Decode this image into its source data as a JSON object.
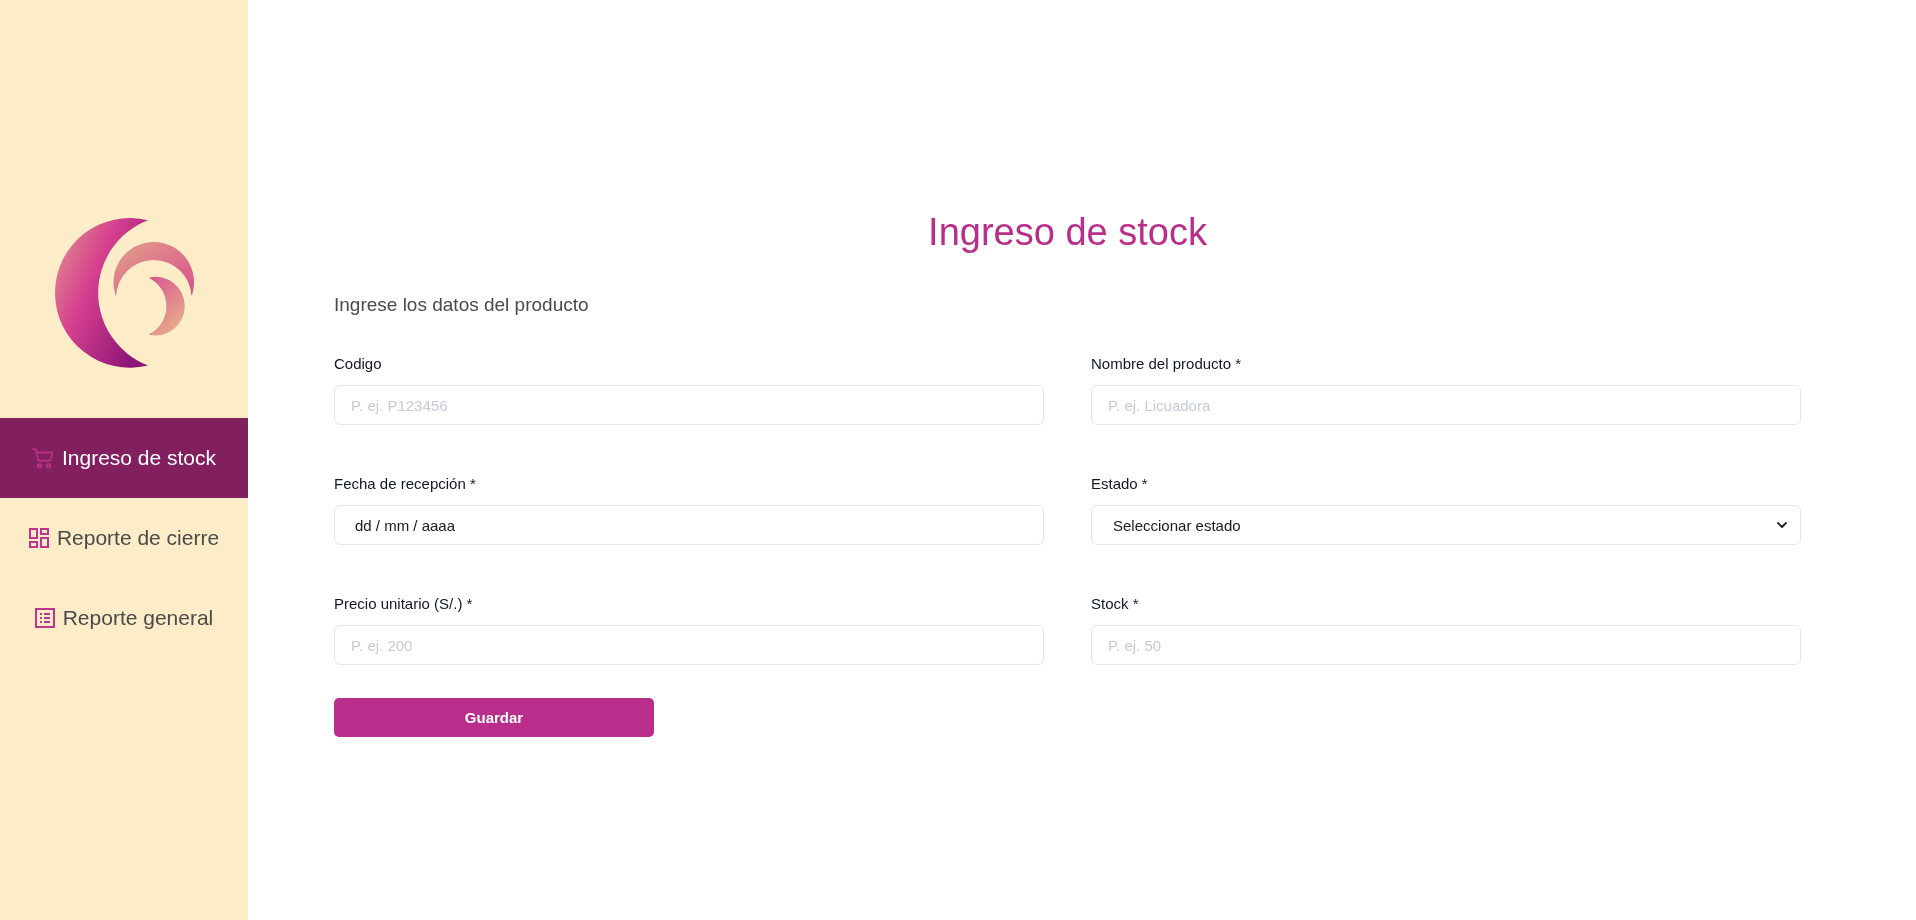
{
  "sidebar": {
    "items": [
      {
        "label": "Ingreso de stock",
        "selected": true
      },
      {
        "label": "Reporte de cierre",
        "selected": false
      },
      {
        "label": "Reporte general",
        "selected": false
      }
    ]
  },
  "form": {
    "title": "Ingreso de stock",
    "subtitle": "Ingrese los datos del producto",
    "fields": [
      {
        "kind": "text",
        "label": "Codigo",
        "placeholder": "P. ej. P123456"
      },
      {
        "kind": "text",
        "label": "Nombre del producto *",
        "placeholder": "P. ej. Licuadora"
      },
      {
        "kind": "date",
        "label": "Fecha de recepción *",
        "value": "dd / mm / aaaa"
      },
      {
        "kind": "select",
        "label": "Estado *",
        "value": "Seleccionar estado"
      },
      {
        "kind": "text",
        "label": "Precio unitario (S/.) *",
        "placeholder": "P. ej. 200"
      },
      {
        "kind": "text",
        "label": "Stock *",
        "placeholder": "P. ej. 50"
      }
    ],
    "submit": "Guardar"
  }
}
